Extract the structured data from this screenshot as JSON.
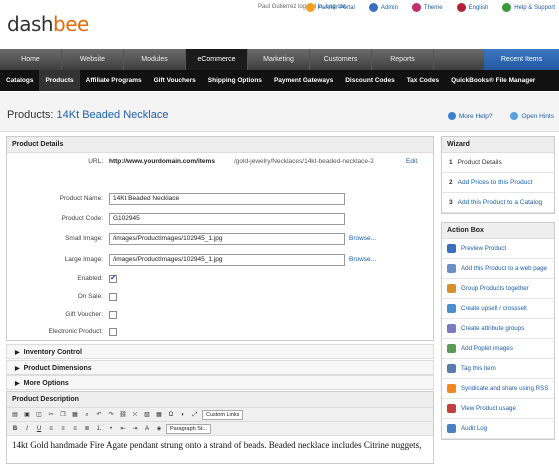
{
  "logo": {
    "part1": "dash",
    "part2": "bee"
  },
  "user": {
    "text": "Paul Gutierrez logged in.",
    "logout": "Log out."
  },
  "toplinks": [
    {
      "label": "Partner Portal",
      "icon": "star-icon",
      "color": "#f0a020"
    },
    {
      "label": "Admin",
      "icon": "gear-icon",
      "color": "#3a6ebf"
    },
    {
      "label": "Theme",
      "icon": "theme-icon",
      "color": "#c0306a"
    },
    {
      "label": "English",
      "icon": "flag-icon",
      "color": "#b22234"
    },
    {
      "label": "Help & Support",
      "icon": "help-icon",
      "color": "#3a9a3a"
    }
  ],
  "mainnav": [
    "Home",
    "Website",
    "Modules",
    "eCommerce",
    "Marketing",
    "Customers",
    "Reports"
  ],
  "mainnav_active": 3,
  "recent": "Recent Items",
  "subnav": [
    "Catalogs",
    "Products",
    "Affiliate Programs",
    "Gift Vouchers",
    "Shipping Options",
    "Payment Gateways",
    "Discount Codes",
    "Tax Codes",
    "QuickBooks® File Manager"
  ],
  "subnav_active": 1,
  "page": {
    "prefix": "Products:",
    "name": "14Kt Beaded Necklace",
    "more_help": "More Help?",
    "open_hints": "Open Hints"
  },
  "details": {
    "heading": "Product Details",
    "url_label": "URL:",
    "url_base": "http://www.yourdomain.com/items",
    "url_path": "/gold-jewelry/Necklaces/14kt-beaded-necklace-2",
    "url_edit": "Edit",
    "name_label": "Product Name:",
    "name_value": "14Kt Beaded Necklace",
    "code_label": "Product Code:",
    "code_value": "G102945",
    "small_label": "Small Image:",
    "small_value": "/images/ProductImages/102945_1.jpg",
    "large_label": "Large Image:",
    "large_value": "/images/ProductImages/102945_1.jpg",
    "browse": "Browse...",
    "enabled_label": "Enabled:",
    "enabled": true,
    "onsale_label": "On Sale:",
    "gift_label": "Gift Voucher:",
    "electronic_label": "Electronic Product:"
  },
  "sections": [
    "Inventory Control",
    "Product Dimensions",
    "More Options"
  ],
  "description": {
    "heading": "Product Description",
    "style_select": "Custom Links",
    "format_select": "Paragraph St...",
    "text": "14kt Gold handmade Fire Agate pendant strung onto a strand of beads. Beaded necklace includes Citrine nuggets,"
  },
  "wizard": {
    "heading": "Wizard",
    "items": [
      {
        "num": "1",
        "label": "Product Details"
      },
      {
        "num": "2",
        "label": "Add Prices to this Product"
      },
      {
        "num": "3",
        "label": "Add this Product to a Catalog"
      }
    ]
  },
  "actionbox": {
    "heading": "Action Box",
    "items": [
      {
        "label": "Preview Product",
        "icon": "preview-icon",
        "color": "#3a6ebf"
      },
      {
        "label": "Add this Product to a web page",
        "icon": "webpage-icon",
        "color": "#6a8fc8"
      },
      {
        "label": "Group Products together",
        "icon": "group-icon",
        "color": "#d8902a"
      },
      {
        "label": "Create upsell / crosssell",
        "icon": "upsell-icon",
        "color": "#4a90d0"
      },
      {
        "label": "Create attribute groups",
        "icon": "attribute-icon",
        "color": "#7a7ac0"
      },
      {
        "label": "Add Poplet images",
        "icon": "image-icon",
        "color": "#5a9a5a"
      },
      {
        "label": "Tag this item",
        "icon": "tag-icon",
        "color": "#5a7ab0"
      },
      {
        "label": "Syndicate and share using RSS",
        "icon": "rss-icon",
        "color": "#f08a20"
      },
      {
        "label": "View Product usage",
        "icon": "usage-icon",
        "color": "#c04040"
      },
      {
        "label": "Audit Log",
        "icon": "audit-icon",
        "color": "#4a80c0"
      }
    ]
  }
}
